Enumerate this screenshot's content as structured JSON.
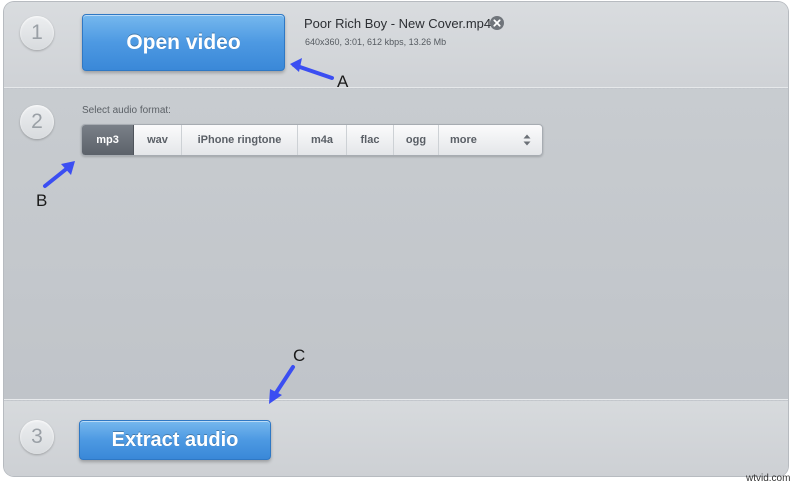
{
  "steps": {
    "one": "1",
    "two": "2",
    "three": "3"
  },
  "open_button": {
    "label": "Open video"
  },
  "file": {
    "name": "Poor Rich Boy - New Cover.mp4",
    "meta": "640x360, 3:01, 612 kbps, 13.26 Mb"
  },
  "audio_format": {
    "label": "Select audio format:",
    "options": [
      "mp3",
      "wav",
      "iPhone ringtone",
      "m4a",
      "flac",
      "ogg",
      "more"
    ],
    "selected": "mp3"
  },
  "extract_button": {
    "label": "Extract audio"
  },
  "annotations": {
    "a": "A",
    "b": "B",
    "c": "C",
    "arrow_color": "#3b4ef2"
  },
  "watermark": "wtvid.com",
  "icons": {
    "remove_file": "close-icon",
    "more_formats": "updown-icon"
  },
  "colors": {
    "button_blue": "#4d99e2",
    "selected_format": "#5c626a"
  }
}
